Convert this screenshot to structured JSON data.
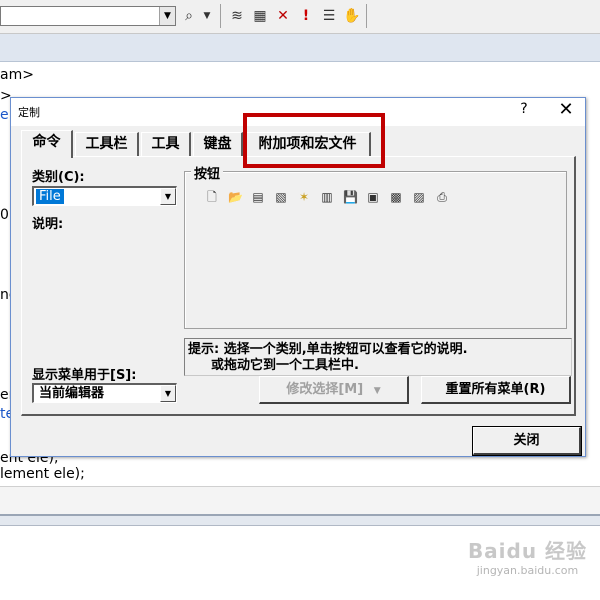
{
  "background": {
    "toolbar_icons": [
      "layers-icon",
      "grid-icon",
      "delete-icon",
      "exclamation-icon",
      "list-icon",
      "hand-icon"
    ],
    "code_lines": [
      "am>",
      ">",
      "e s",
      "0)",
      "ne",
      "en",
      "te",
      "ent ele),",
      "lement ele);"
    ]
  },
  "dialog": {
    "title": "定制",
    "help": "?",
    "close": "✕",
    "tabs": [
      {
        "label": "命令",
        "active": true
      },
      {
        "label": "工具栏",
        "active": false
      },
      {
        "label": "工具",
        "active": false
      },
      {
        "label": "键盘",
        "active": false
      },
      {
        "label": "附加项和宏文件",
        "active": false
      }
    ],
    "category": {
      "label": "类别(C):",
      "value": "File"
    },
    "description_label": "说明:",
    "buttons_group": {
      "label": "按钮",
      "icons": [
        "new-file-icon",
        "open-folder-icon",
        "file-icon",
        "file-sparkle-icon",
        "file-star-icon",
        "file-open-icon",
        "save-icon",
        "save-all-icon",
        "print-setup-icon",
        "print-preview-icon",
        "printer-icon"
      ]
    },
    "hint": {
      "line1": "提示: 选择一个类别,单击按钮可以查看它的说明.",
      "line2": "或拖动它到一个工具栏中."
    },
    "show_menu": {
      "label": "显示菜单用于[S]:",
      "value": "当前编辑器"
    },
    "modify_selection_label": "修改选择[M]",
    "reset_menus_label": "重置所有菜单(R)",
    "close_label": "关闭"
  },
  "watermark": {
    "brand": "Baidu 经验",
    "url": "jingyan.baidu.com"
  },
  "colors": {
    "dialog_bg": "#f0f0f0",
    "highlight": "#c00000",
    "selection": "#0078d7"
  }
}
